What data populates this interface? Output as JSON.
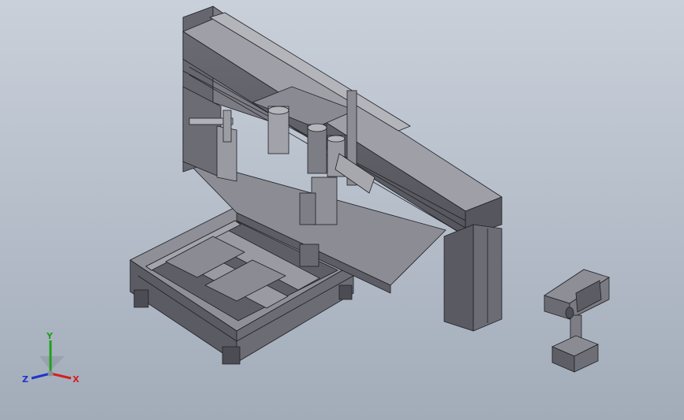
{
  "viewport": {
    "background_top": "#c9d0da",
    "background_bottom": "#a2acb9",
    "model_color": "#6e6f76",
    "edge_color": "#1f1f24"
  },
  "triad": {
    "x_label": "X",
    "y_label": "Y",
    "z_label": "Z",
    "x_color": "#d42020",
    "y_color": "#1ea01e",
    "z_color": "#1f35c8"
  }
}
